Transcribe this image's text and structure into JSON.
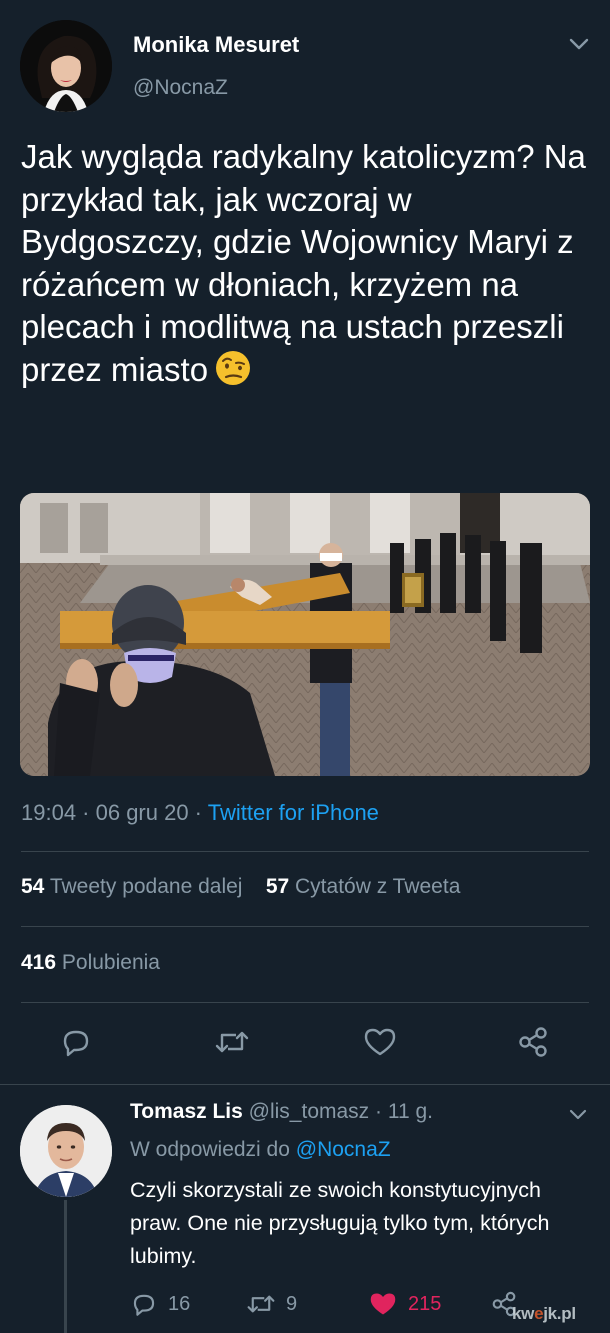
{
  "tweet": {
    "author_name": "Monika Mesuret",
    "author_handle": "@NocnaZ",
    "text": "Jak wygląda radykalny katolicyzm? Na przykład tak, jak wczoraj w Bydgoszczy, gdzie Wojownicy Maryi z różańcem w dłoniach, krzyżem na plecach i modlitwą na ustach przeszli przez miasto",
    "emoji": "face-with-raised-eyebrow-icon",
    "timestamp": "19:04 · 06 gru 20 · ",
    "source": "Twitter for iPhone",
    "retweets_count": "54",
    "retweets_label": "Tweety podane dalej",
    "quotes_count": "57",
    "quotes_label": "Cytatów z Tweeta",
    "likes_count": "416",
    "likes_label": "Polubienia"
  },
  "reply": {
    "author_name": "Tomasz Lis",
    "author_handle": "@lis_tomasz",
    "time": " · 11 g.",
    "reply_to_label": "W odpowiedzi do ",
    "reply_to_handle": "@NocnaZ",
    "text": "Czyli skorzystali ze swoich konstytucyjnych praw. One nie przysługują tylko tym, których lubimy.",
    "replies_count": "16",
    "retweets_count": "9",
    "likes_count": "215"
  },
  "watermark": {
    "part1": "kw",
    "part2": "e",
    "part3": "jk.pl"
  },
  "colors": {
    "background": "#15202b",
    "accent": "#1da1f2",
    "secondary_text": "#8899a6",
    "like": "#e0245e"
  }
}
